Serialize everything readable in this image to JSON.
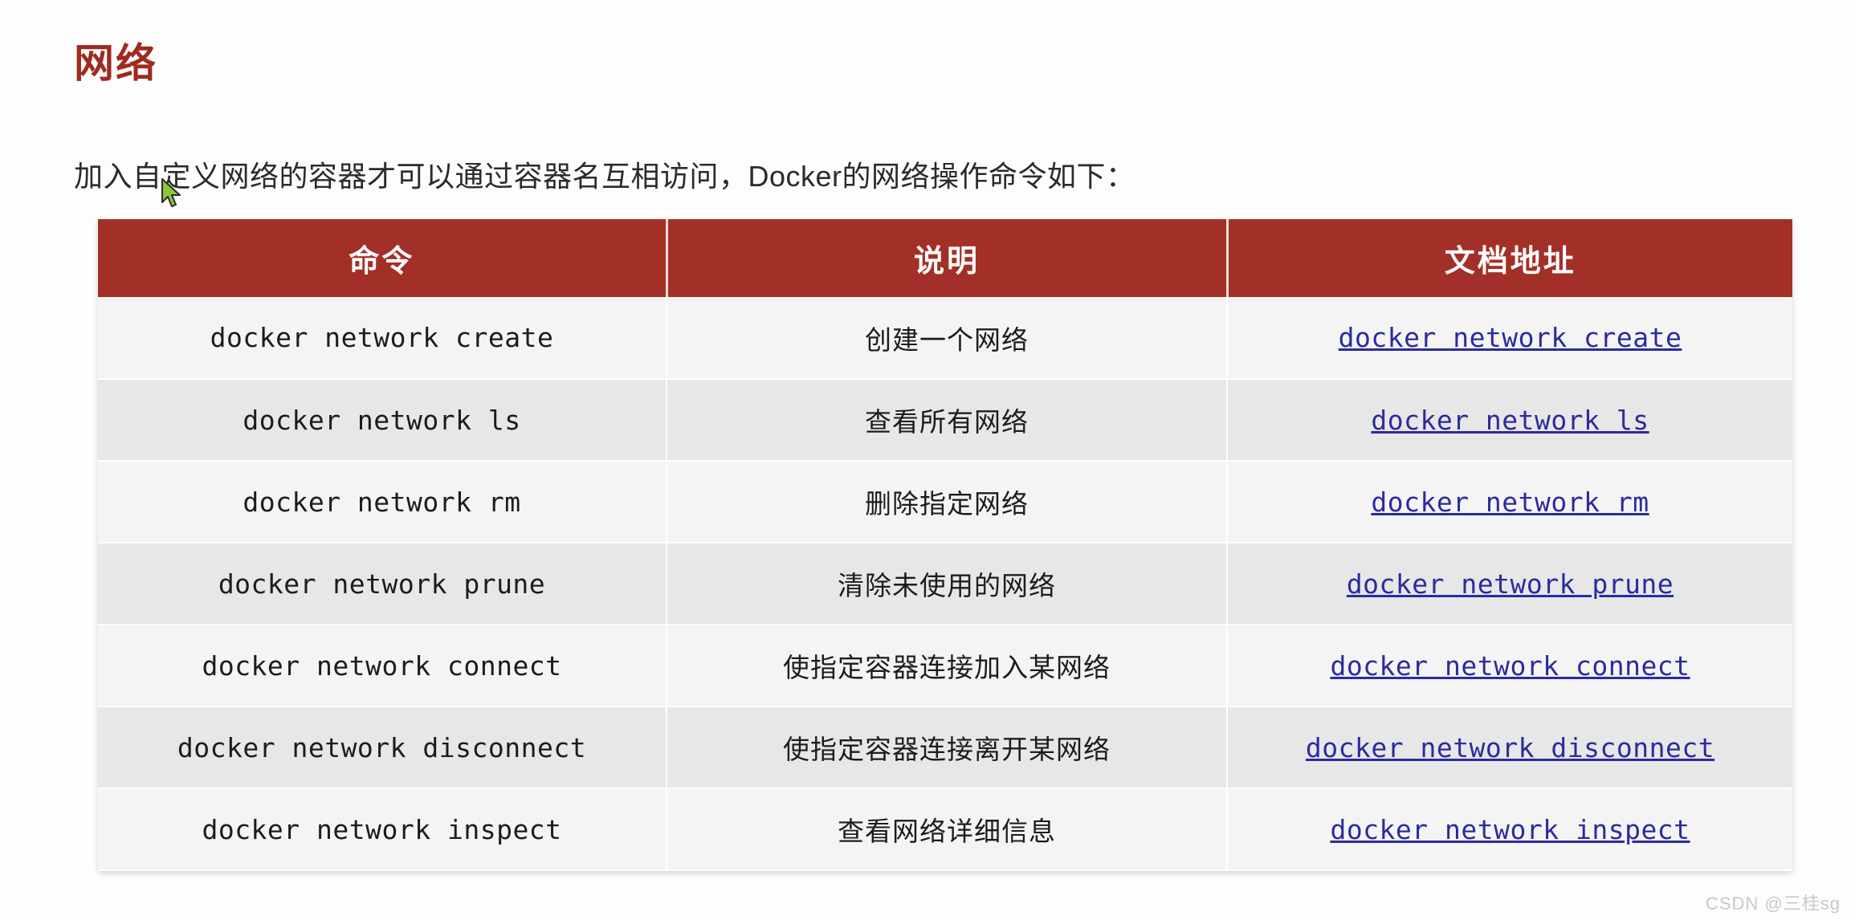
{
  "page": {
    "section_title": "网络",
    "intro_paragraph": "加入自定义网络的容器才可以通过容器名互相访问，Docker的网络操作命令如下：",
    "watermark": "CSDN @三桂sg"
  },
  "colors": {
    "heading": "#9e2b20",
    "table_header_bg": "#a33028",
    "table_header_text": "#ffffff",
    "row_odd_bg": "#f4f4f4",
    "row_even_bg": "#e7e7e7",
    "link": "#2b2b9e",
    "cursor": "#8cc63f"
  },
  "table": {
    "headers": [
      "命令",
      "说明",
      "文档地址"
    ],
    "rows": [
      {
        "command": "docker network create",
        "description": "创建一个网络",
        "doc_link": "docker network create"
      },
      {
        "command": "docker network ls",
        "description": "查看所有网络",
        "doc_link": "docker network ls"
      },
      {
        "command": "docker network rm",
        "description": "删除指定网络",
        "doc_link": "docker network rm"
      },
      {
        "command": "docker network prune",
        "description": "清除未使用的网络",
        "doc_link": "docker network prune"
      },
      {
        "command": "docker network connect",
        "description": "使指定容器连接加入某网络",
        "doc_link": "docker network connect"
      },
      {
        "command": "docker network disconnect",
        "description": "使指定容器连接离开某网络",
        "doc_link": "docker network disconnect"
      },
      {
        "command": "docker network inspect",
        "description": "查看网络详细信息",
        "doc_link": "docker network inspect"
      }
    ]
  }
}
